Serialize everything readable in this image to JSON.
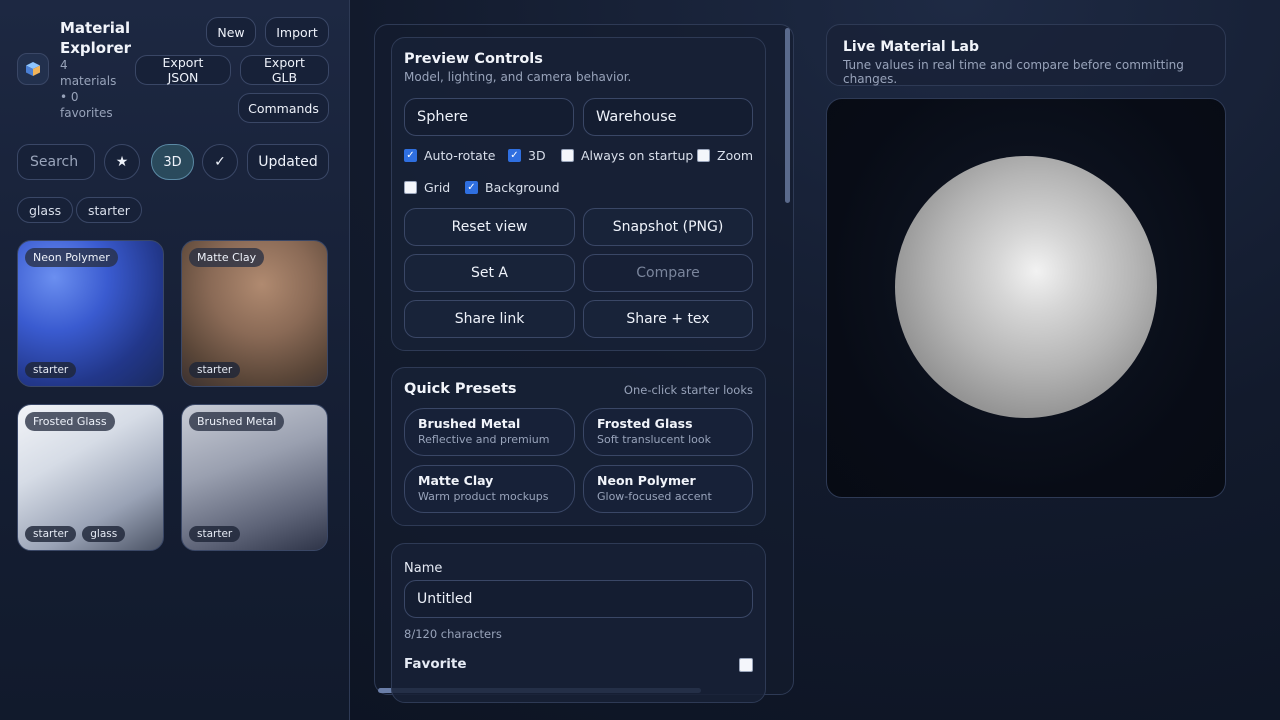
{
  "sidebar": {
    "brand_title": "Material Explorer",
    "brand_stats": "4 materials • 0 favorites",
    "buttons": {
      "new": "New",
      "import": "Import",
      "export_json": "Export JSON",
      "export_glb": "Export GLB",
      "commands": "Commands"
    },
    "search_placeholder": "Search materials",
    "filters": {
      "favorites": "★",
      "three_d": "3D",
      "check": "✓",
      "sort": "Updated"
    },
    "tag_chips": [
      "glass",
      "starter"
    ],
    "cards": [
      {
        "name": "Neon Polymer",
        "tags": [
          "starter"
        ]
      },
      {
        "name": "Matte Clay",
        "tags": [
          "starter"
        ]
      },
      {
        "name": "Frosted Glass",
        "tags": [
          "starter",
          "glass"
        ]
      },
      {
        "name": "Brushed Metal",
        "tags": [
          "starter"
        ]
      }
    ]
  },
  "preview": {
    "title": "Preview Controls",
    "subtitle": "Model, lighting, and camera behavior.",
    "model_select": "Sphere",
    "environment_select": "Warehouse",
    "checks": {
      "auto_rotate": {
        "label": "Auto-rotate",
        "checked": true
      },
      "three_d": {
        "label": "3D",
        "checked": true
      },
      "always_on_startup": {
        "label": "Always on startup",
        "checked": false
      },
      "zoom": {
        "label": "Zoom",
        "checked": false
      },
      "grid": {
        "label": "Grid",
        "checked": false
      },
      "background": {
        "label": "Background",
        "checked": true
      }
    },
    "buttons": {
      "reset_view": "Reset view",
      "snapshot": "Snapshot (PNG)",
      "set_a": "Set A",
      "compare": "Compare",
      "share_link": "Share link",
      "share_tex": "Share + tex"
    }
  },
  "presets": {
    "title": "Quick Presets",
    "hint": "One-click starter looks",
    "items": [
      {
        "name": "Brushed Metal",
        "desc": "Reflective and premium"
      },
      {
        "name": "Frosted Glass",
        "desc": "Soft translucent look"
      },
      {
        "name": "Matte Clay",
        "desc": "Warm product mockups"
      },
      {
        "name": "Neon Polymer",
        "desc": "Glow-focused accent"
      }
    ]
  },
  "editor": {
    "name_label": "Name",
    "name_value": "Untitled",
    "char_count": "8/120 characters",
    "favorite_label": "Favorite"
  },
  "lab": {
    "title": "Live Material Lab",
    "subtitle": "Tune values in real time and compare before committing changes."
  },
  "colors": {
    "accent": "#2f6fe0",
    "neon_polymer": "#3a5bd0",
    "matte_clay": "#8a6a56",
    "frosted_glass": "#d6dce6",
    "brushed_metal": "#9aa0b0"
  }
}
